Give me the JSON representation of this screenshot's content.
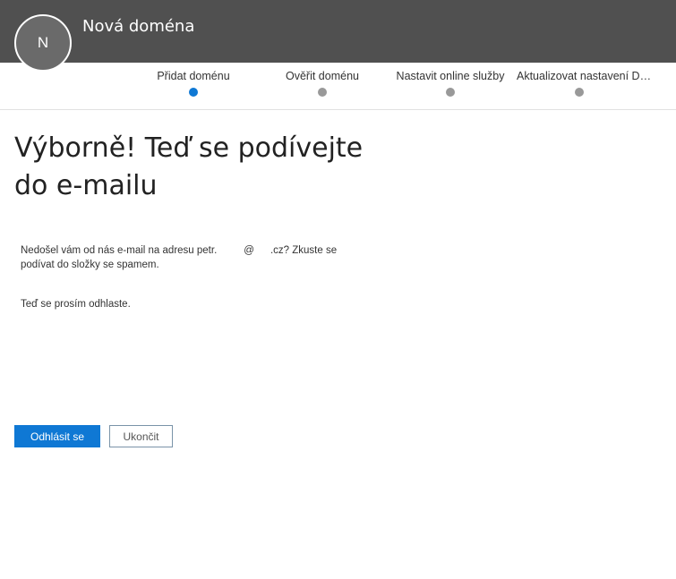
{
  "header": {
    "avatar_initial": "N",
    "title": "Nová doména"
  },
  "steps": [
    {
      "label": "Přidat doménu",
      "state": "active"
    },
    {
      "label": "Ověřit doménu",
      "state": "pending"
    },
    {
      "label": "Nastavit online služby",
      "state": "pending"
    },
    {
      "label": "Aktualizovat nastavení D…",
      "state": "pending"
    }
  ],
  "main": {
    "headline_line1": "Výborně! Teď se podívejte",
    "headline_line2": "do e-mailu",
    "info_part1": "Nedošel vám od nás e-mail na adresu petr.",
    "info_at": "@",
    "info_part2": ".cz? Zkuste se podívat do složky se spamem.",
    "signout_text": "Teď se prosím odhlaste."
  },
  "buttons": {
    "primary": "Odhlásit se",
    "secondary": "Ukončit"
  },
  "colors": {
    "header_bg": "#505050",
    "accent": "#0f78d4",
    "inactive_dot": "#999999"
  }
}
